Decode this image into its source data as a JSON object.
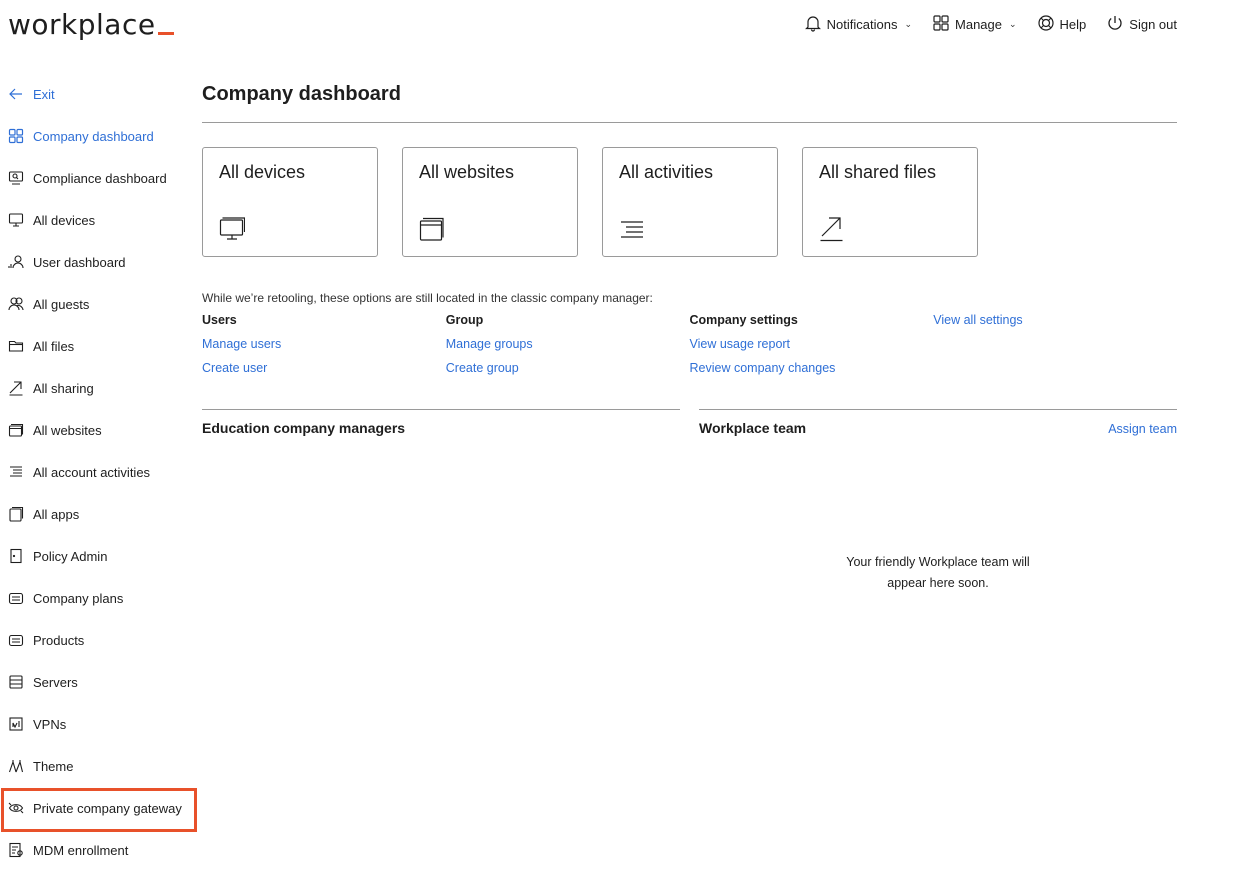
{
  "brand": {
    "name": "workplace",
    "accent": "#e8512a",
    "link_color": "#2f6fd6"
  },
  "topnav": {
    "notifications": "Notifications",
    "manage": "Manage",
    "help": "Help",
    "signout": "Sign out"
  },
  "sidebar": {
    "items": [
      {
        "label": "Exit",
        "icon": "arrow-left-icon"
      },
      {
        "label": "Company dashboard",
        "icon": "grid-icon"
      },
      {
        "label": "Compliance dashboard",
        "icon": "monitor-search-icon"
      },
      {
        "label": "All devices",
        "icon": "monitor-icon"
      },
      {
        "label": "User dashboard",
        "icon": "user-chart-icon"
      },
      {
        "label": "All guests",
        "icon": "guests-icon"
      },
      {
        "label": "All files",
        "icon": "folder-icon"
      },
      {
        "label": "All sharing",
        "icon": "share-arrow-icon"
      },
      {
        "label": "All websites",
        "icon": "windows-icon"
      },
      {
        "label": "All account activities",
        "icon": "activity-lines-icon"
      },
      {
        "label": "All apps",
        "icon": "apps-icon"
      },
      {
        "label": "Policy Admin",
        "icon": "door-icon"
      },
      {
        "label": "Company plans",
        "icon": "plans-icon"
      },
      {
        "label": "Products",
        "icon": "products-icon"
      },
      {
        "label": "Servers",
        "icon": "server-icon"
      },
      {
        "label": "VPNs",
        "icon": "vpn-icon"
      },
      {
        "label": "Theme",
        "icon": "theme-icon"
      },
      {
        "label": "Private company gateway",
        "icon": "gateway-icon"
      },
      {
        "label": "MDM enrollment",
        "icon": "mdm-icon"
      }
    ]
  },
  "main": {
    "title": "Company dashboard",
    "cards": [
      {
        "label": "All devices",
        "icon": "monitor-icon"
      },
      {
        "label": "All websites",
        "icon": "windows-icon"
      },
      {
        "label": "All activities",
        "icon": "activity-lines-icon"
      },
      {
        "label": "All shared files",
        "icon": "share-arrow-icon"
      }
    ],
    "intro": "While we’re retooling, these options are still located in the classic company manager:",
    "legacy": {
      "users": {
        "head": "Users",
        "links": [
          "Manage users",
          "Create user"
        ]
      },
      "group": {
        "head": "Group",
        "links": [
          "Manage groups",
          "Create group"
        ]
      },
      "company": {
        "head": "Company settings",
        "links": [
          "View usage report",
          "Review company changes"
        ]
      },
      "view_all": "View all settings"
    },
    "managers_panel": {
      "title": "Education company managers"
    },
    "team_panel": {
      "title": "Workplace team",
      "link": "Assign team",
      "empty_line1": "Your friendly Workplace team will",
      "empty_line2": "appear here soon."
    }
  }
}
